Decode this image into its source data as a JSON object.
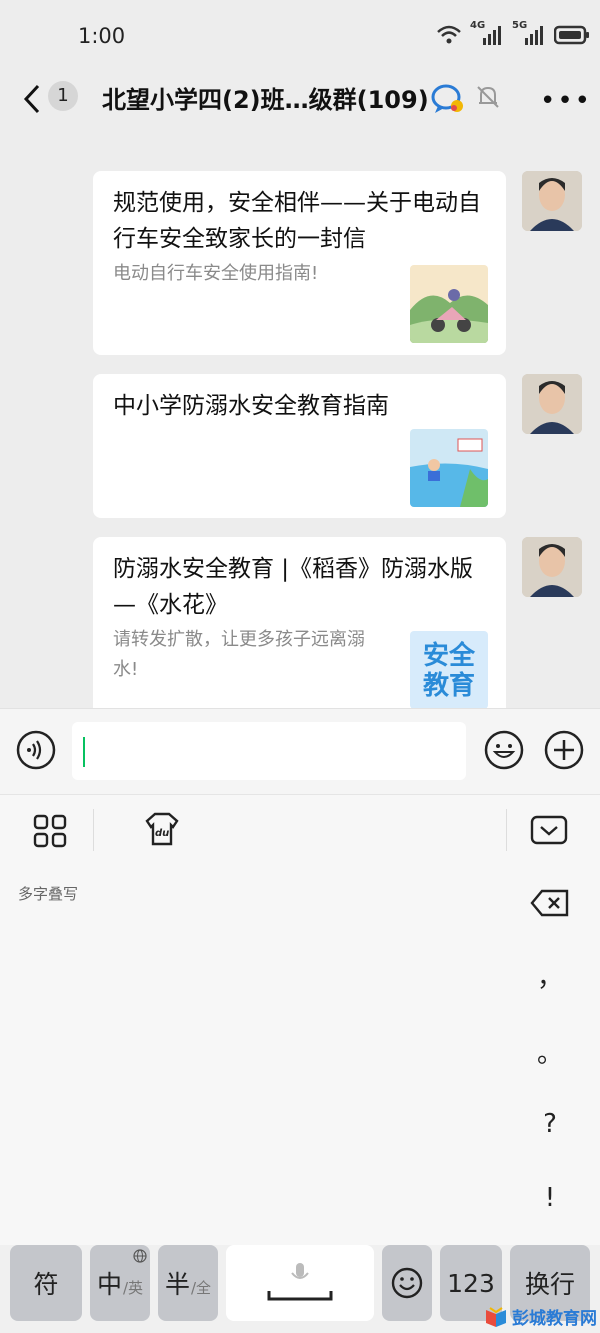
{
  "status_bar": {
    "time": "1:00",
    "net_1": "4G",
    "net_2": "5G"
  },
  "header": {
    "back_unread": "1",
    "title": "北望小学四(2)班…级群(109)",
    "brand_icon": "chat-bubble-brand-icon",
    "mute_icon": "bell-off-icon",
    "more_label": "•••"
  },
  "messages": [
    {
      "title": "规范使用，安全相伴——关于电动自行车安全致家长的一封信",
      "desc": "电动自行车安全使用指南!",
      "thumb": "scooter-illustration"
    },
    {
      "title": "中小学防溺水安全教育指南",
      "desc": "",
      "thumb": "swimming-illustration"
    },
    {
      "title": "防溺水安全教育 |《稻香》防溺水版—《水花》",
      "desc": "请转发扩散，让更多孩子远离溺水!",
      "thumb_text": "安全教育"
    }
  ],
  "input_bar": {
    "value": ""
  },
  "keyboard": {
    "handwriting_hint": "多字叠写",
    "punctuation": [
      "，",
      "。",
      "?",
      "!"
    ],
    "keys": {
      "symbol": "符",
      "chinese": "中",
      "english_sub": "/英",
      "half": "半",
      "full_sub": "/全",
      "numbers": "123",
      "enter": "换行"
    }
  },
  "watermark": "彭城教育网",
  "colors": {
    "bg": "#ededed",
    "accent": "#07c160",
    "key": "#c4c6cb"
  }
}
